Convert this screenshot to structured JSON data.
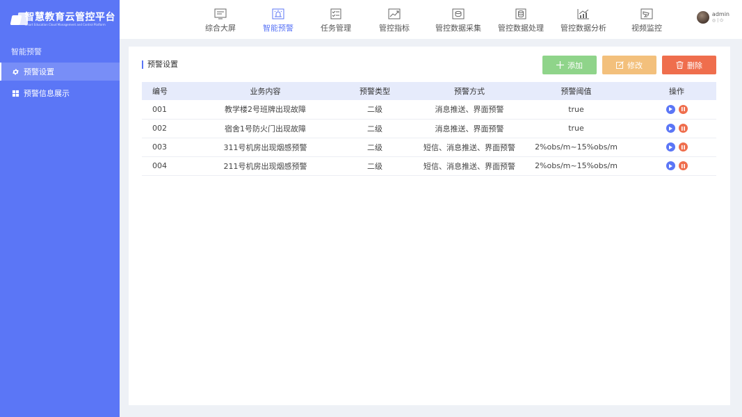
{
  "brand": {
    "title": "智慧教育云管控平台",
    "subtitle": "Smart Education Cloud Management and Control Platform"
  },
  "sidebar": {
    "section_label": "智能预警",
    "items": [
      {
        "label": "预警设置",
        "icon": "gear-icon",
        "active": true
      },
      {
        "label": "预警信息展示",
        "icon": "grid-icon",
        "active": false
      }
    ]
  },
  "nav": {
    "items": [
      {
        "label": "综合大屏",
        "icon": "monitor-icon",
        "active": false
      },
      {
        "label": "智能预警",
        "icon": "alarm-icon",
        "active": true
      },
      {
        "label": "任务管理",
        "icon": "checklist-icon",
        "active": false
      },
      {
        "label": "管控指标",
        "icon": "trend-chart-icon",
        "active": false
      },
      {
        "label": "管控数据采集",
        "icon": "data-collect-icon",
        "active": false
      },
      {
        "label": "管控数据处理",
        "icon": "data-process-icon",
        "active": false
      },
      {
        "label": "管控数据分析",
        "icon": "bar-analysis-icon",
        "active": false
      },
      {
        "label": "视频监控",
        "icon": "camera-icon",
        "active": false
      }
    ]
  },
  "user": {
    "name": "admin",
    "icons": [
      "settings-icon",
      "divider",
      "power-icon"
    ],
    "divider": "|"
  },
  "panel": {
    "title": "预警设置",
    "buttons": {
      "add": "添加",
      "edit": "修改",
      "delete": "删除"
    },
    "colors": {
      "add": "#8fd48a",
      "edit": "#f3c07c",
      "delete": "#ef6e4d",
      "accent": "#5b76f6"
    },
    "table": {
      "headers": [
        "编号",
        "业务内容",
        "预警类型",
        "预警方式",
        "预警阈值",
        "操作"
      ],
      "rows": [
        {
          "id": "001",
          "content": "教学楼2号班牌出现故障",
          "type": "二级",
          "method": "消息推送、界面预警",
          "threshold": "true"
        },
        {
          "id": "002",
          "content": "宿舍1号防火门出现故障",
          "type": "二级",
          "method": "消息推送、界面预警",
          "threshold": "true"
        },
        {
          "id": "003",
          "content": "311号机房出现烟感预警",
          "type": "二级",
          "method": "短信、消息推送、界面预警",
          "threshold": "2%obs/m~15%obs/m"
        },
        {
          "id": "004",
          "content": "211号机房出现烟感预警",
          "type": "二级",
          "method": "短信、消息推送、界面预警",
          "threshold": "2%obs/m~15%obs/m"
        }
      ]
    }
  }
}
